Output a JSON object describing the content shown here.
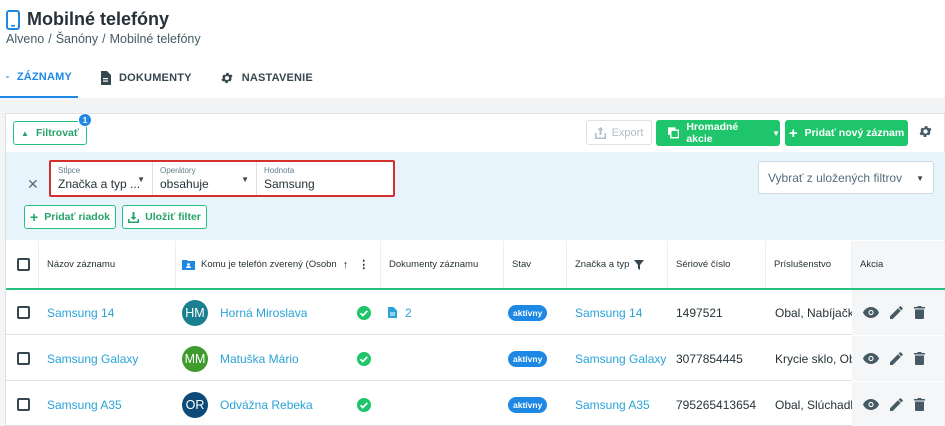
{
  "page": {
    "title": "Mobilné telefóny",
    "breadcrumb": [
      "Alveno",
      "/",
      "Šanóny",
      "/",
      "Mobilné telefóny"
    ]
  },
  "tabs": [
    {
      "label": "ZÁZNAMY",
      "icon": "list-icon",
      "active": true
    },
    {
      "label": "DOKUMENTY",
      "icon": "document-icon",
      "active": false
    },
    {
      "label": "NASTAVENIE",
      "icon": "gear-icon",
      "active": false
    }
  ],
  "toolbar": {
    "filter_label": "Filtrovať",
    "filter_count": "1",
    "export_label": "Export",
    "bulk_label": "Hromadné akcie",
    "add_label": "Pridať nový záznam"
  },
  "filter": {
    "column_label": "Stĺpce",
    "column_value": "Značka a typ ...",
    "operator_label": "Operátory",
    "operator_value": "obsahuje",
    "value_label": "Hodnota",
    "value_value": "Samsung",
    "saved_filters_placeholder": "Vybrať z uložených filtrov",
    "add_row_label": "Pridať riadok",
    "save_filter_label": "Uložiť filter"
  },
  "table": {
    "columns": [
      "Názov záznamu",
      "Komu je telefón zverený (Osobn",
      "Dokumenty záznamu",
      "Stav",
      "Značka a typ",
      "Sériové číslo",
      "Príslušenstvo",
      "Akcia"
    ],
    "rows": [
      {
        "name": "Samsung 14",
        "avatar": "HM",
        "avatar_color": "#1a7f8e",
        "person": "Horná Miroslava",
        "docs": "2",
        "status": "aktívny",
        "brand": "Samsung 14",
        "serial": "1497521",
        "accessories": "Obal, Nabíjačka"
      },
      {
        "name": "Samsung Galaxy",
        "avatar": "MM",
        "avatar_color": "#3f9b2e",
        "person": "Matuška Mário",
        "docs": "",
        "status": "aktívny",
        "brand": "Samsung Galaxy",
        "serial": "3077854445",
        "accessories": "Krycie sklo, Obal"
      },
      {
        "name": "Samsung A35",
        "avatar": "OR",
        "avatar_color": "#0d4a78",
        "person": "Odvážna Rebeka",
        "docs": "",
        "status": "aktívny",
        "brand": "Samsung A35",
        "serial": "795265413654",
        "accessories": "Obal, Slúchadlá,"
      }
    ]
  },
  "colors": {
    "accent": "#1e88e5",
    "green": "#1ec56a",
    "link": "#2aa3d8",
    "highlight": "#d32f2f"
  }
}
